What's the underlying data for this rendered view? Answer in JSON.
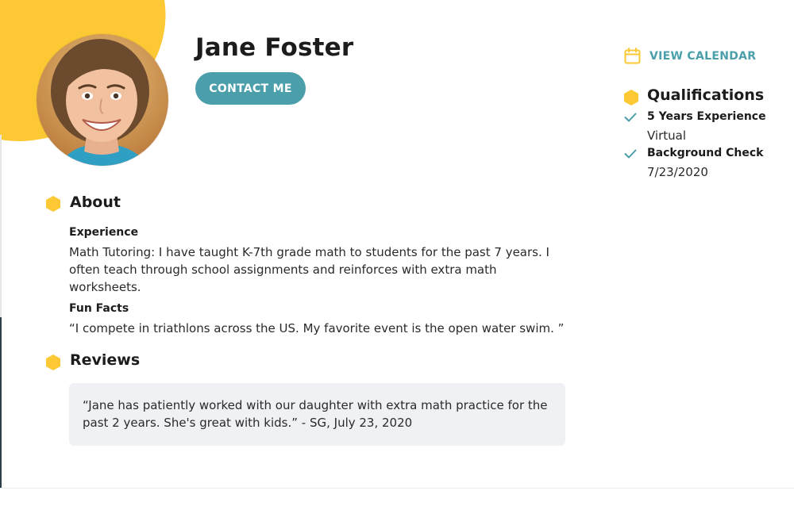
{
  "profile": {
    "name": "Jane Foster",
    "contact_label": "CONTACT ME"
  },
  "about": {
    "title": "About",
    "experience_heading": "Experience",
    "experience_text": "Math Tutoring: I have taught K-7th grade math to students for the past 7 years. I often teach through school assignments and reinforces with extra math worksheets.",
    "fun_facts_heading": "Fun Facts",
    "fun_facts_text": "“I compete in triathlons across the US. My favorite event is the open water swim. ”"
  },
  "reviews": {
    "title": "Reviews",
    "items": [
      {
        "text": "“Jane has patiently worked with our daughter with extra math practice for the past 2 years. She's great with kids.” - SG, July 23, 2020"
      }
    ]
  },
  "sidebar": {
    "view_calendar_label": "VIEW CALENDAR",
    "calendar_icon": "calendar-icon",
    "qualifications_title": "Qualifications",
    "qualifications": [
      {
        "label": "5 Years Experience",
        "detail": "Virtual"
      },
      {
        "label": "Background Check",
        "detail": "7/23/2020"
      }
    ]
  },
  "colors": {
    "accent_yellow": "#fcc934",
    "accent_teal": "#4a9faa",
    "review_bg": "#f0f1f4"
  }
}
